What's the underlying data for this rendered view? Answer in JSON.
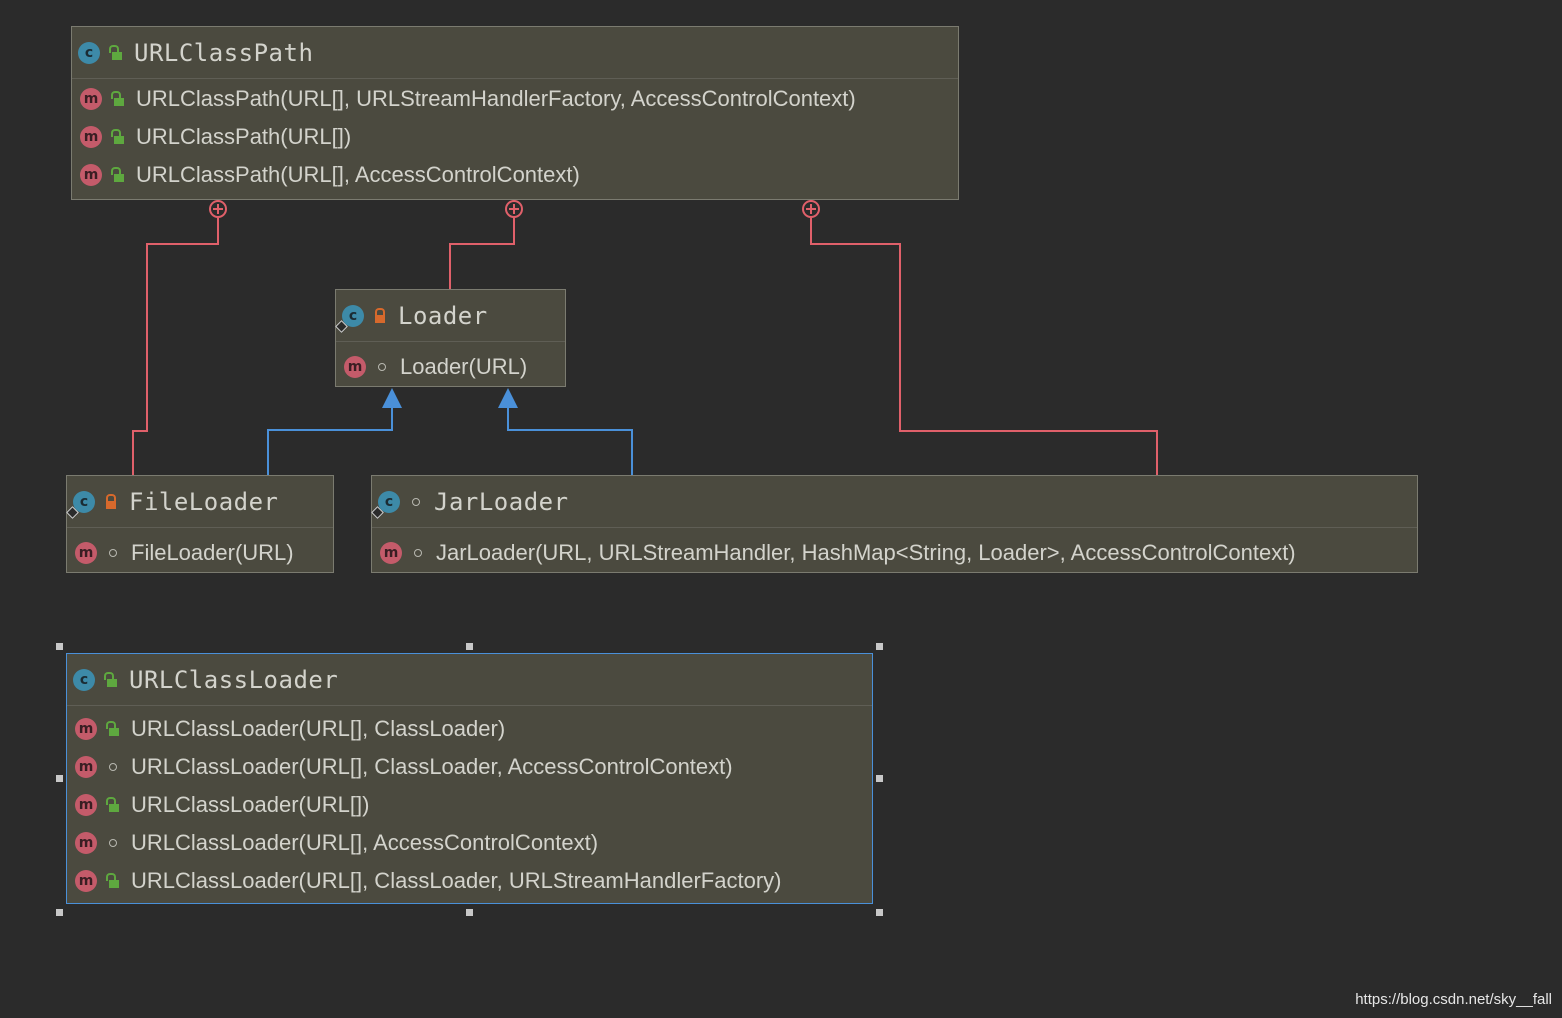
{
  "classes": {
    "urlclasspath": {
      "name": "URLClassPath",
      "visibility": "public",
      "members": [
        {
          "label": "URLClassPath(URL[], URLStreamHandlerFactory, AccessControlContext)",
          "visibility": "public"
        },
        {
          "label": "URLClassPath(URL[])",
          "visibility": "public"
        },
        {
          "label": "URLClassPath(URL[], AccessControlContext)",
          "visibility": "public"
        }
      ]
    },
    "loader": {
      "name": "Loader",
      "visibility": "private",
      "members": [
        {
          "label": "Loader(URL)",
          "visibility": "package"
        }
      ]
    },
    "fileloader": {
      "name": "FileLoader",
      "visibility": "private",
      "members": [
        {
          "label": "FileLoader(URL)",
          "visibility": "package"
        }
      ]
    },
    "jarloader": {
      "name": "JarLoader",
      "visibility": "package",
      "members": [
        {
          "label": "JarLoader(URL, URLStreamHandler, HashMap<String, Loader>, AccessControlContext)",
          "visibility": "package"
        }
      ]
    },
    "urlclassloader": {
      "name": "URLClassLoader",
      "visibility": "public",
      "members": [
        {
          "label": "URLClassLoader(URL[], ClassLoader)",
          "visibility": "public"
        },
        {
          "label": "URLClassLoader(URL[], ClassLoader, AccessControlContext)",
          "visibility": "package"
        },
        {
          "label": "URLClassLoader(URL[])",
          "visibility": "public"
        },
        {
          "label": "URLClassLoader(URL[], AccessControlContext)",
          "visibility": "package"
        },
        {
          "label": "URLClassLoader(URL[], ClassLoader, URLStreamHandlerFactory)",
          "visibility": "public"
        }
      ]
    }
  },
  "relations": [
    {
      "type": "inner-class",
      "from": "fileloader",
      "to": "urlclasspath"
    },
    {
      "type": "inner-class",
      "from": "loader",
      "to": "urlclasspath"
    },
    {
      "type": "inner-class",
      "from": "jarloader",
      "to": "urlclasspath"
    },
    {
      "type": "extends",
      "from": "fileloader",
      "to": "loader"
    },
    {
      "type": "extends",
      "from": "jarloader",
      "to": "loader"
    }
  ],
  "icons": {
    "class_letter": "c",
    "method_letter": "m"
  },
  "colors": {
    "background": "#2b2b2b",
    "node_fill": "#4b4a3f",
    "inner_class_line": "#e0606a",
    "extends_line": "#4a90d9",
    "selection": "#4a90d9"
  },
  "watermark": "https://blog.csdn.net/sky__fall"
}
